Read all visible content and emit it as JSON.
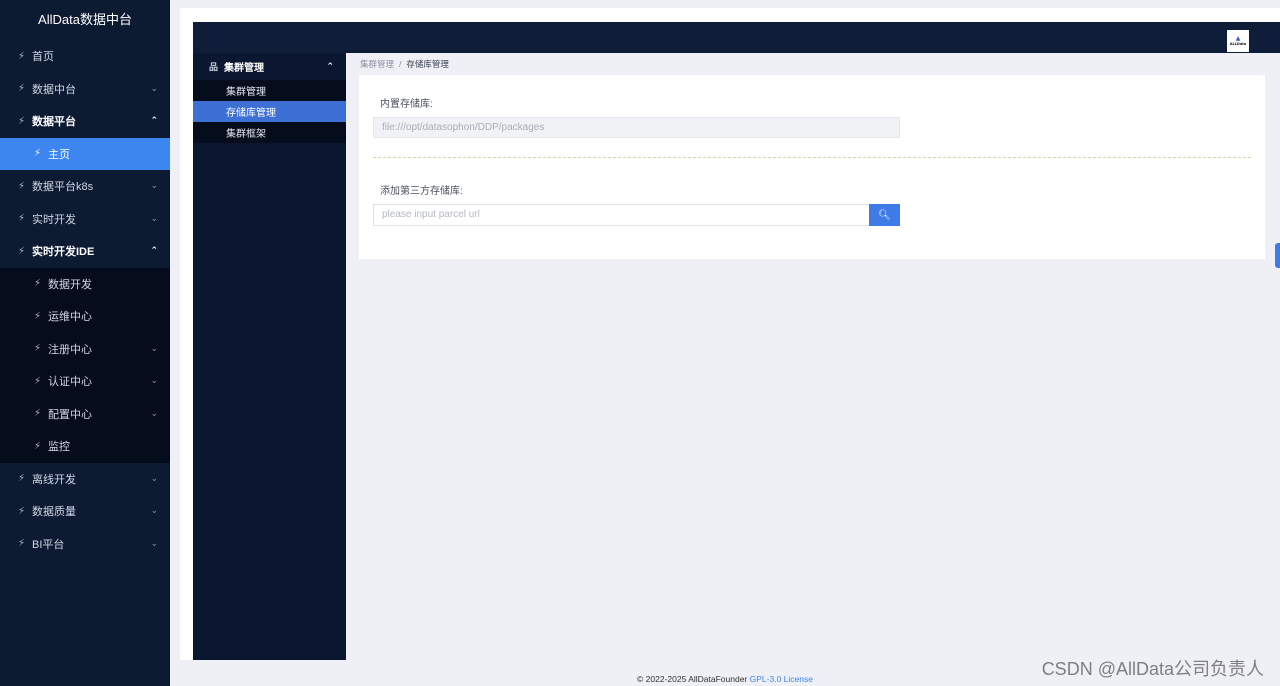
{
  "sidebar": {
    "brand": "AllData数据中台",
    "items": [
      {
        "label": "首页",
        "chev": "",
        "type": "normal"
      },
      {
        "label": "数据中台",
        "chev": "⌄",
        "type": "normal"
      },
      {
        "label": "数据平台",
        "chev": "⌃",
        "type": "bold"
      },
      {
        "label": "主页",
        "chev": "",
        "type": "active"
      },
      {
        "label": "数据平台k8s",
        "chev": "⌄",
        "type": "normal"
      },
      {
        "label": "实时开发",
        "chev": "⌄",
        "type": "normal"
      },
      {
        "label": "实时开发IDE",
        "chev": "⌃",
        "type": "bold"
      },
      {
        "label": "数据开发",
        "chev": "",
        "type": "sub"
      },
      {
        "label": "运维中心",
        "chev": "",
        "type": "sub"
      },
      {
        "label": "注册中心",
        "chev": "⌄",
        "type": "sub"
      },
      {
        "label": "认证中心",
        "chev": "⌄",
        "type": "sub"
      },
      {
        "label": "配置中心",
        "chev": "⌄",
        "type": "sub"
      },
      {
        "label": "监控",
        "chev": "",
        "type": "sub"
      },
      {
        "label": "离线开发",
        "chev": "⌄",
        "type": "normal"
      },
      {
        "label": "数据质量",
        "chev": "⌄",
        "type": "normal"
      },
      {
        "label": "BI平台",
        "chev": "⌄",
        "type": "normal"
      }
    ]
  },
  "topbar": {
    "logo_text": "ALLData"
  },
  "subnav": {
    "group_label": "集群管理",
    "items": [
      {
        "label": "集群管理",
        "active": false
      },
      {
        "label": "存储库管理",
        "active": true
      },
      {
        "label": "集群框架",
        "active": false
      }
    ]
  },
  "breadcrumb": {
    "parent": "集群管理",
    "sep": "/",
    "current": "存储库管理"
  },
  "repo": {
    "builtin_label": "内置存储库:",
    "builtin_value": "file:///opt/datasophon/DDP/packages",
    "thirdparty_label": "添加第三方存储库:",
    "thirdparty_placeholder": "please input parcel url"
  },
  "footer": {
    "copyright": "© 2022-2025 AllDataFounder",
    "license": "GPL-3.0 License"
  },
  "watermark": "CSDN @AllData公司负责人",
  "colors": {
    "sidebar_bg": "#0c1a32",
    "accent": "#3d86f0",
    "button": "#3e7be6"
  }
}
